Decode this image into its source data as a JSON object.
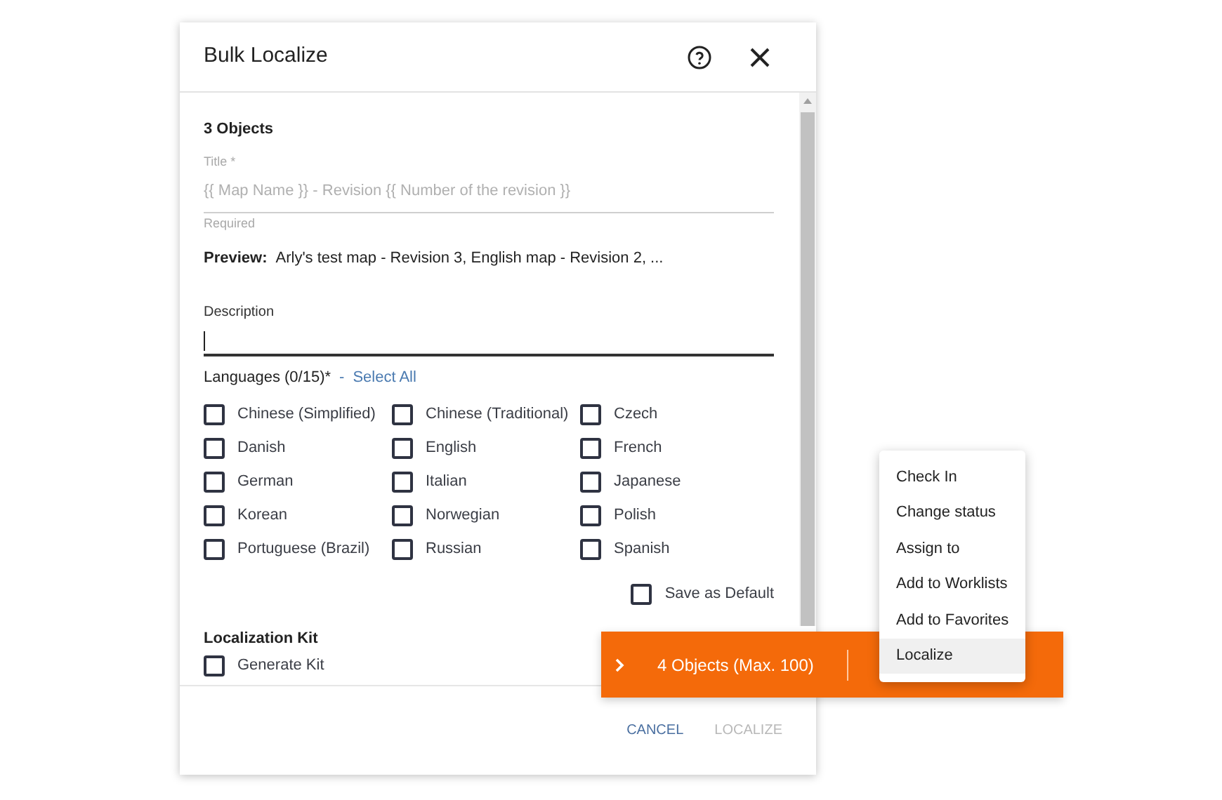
{
  "dialog": {
    "title": "Bulk Localize",
    "objects_heading": "3 Objects",
    "title_field": {
      "label": "Title *",
      "placeholder": "{{ Map Name }} - Revision {{ Number of the revision }}",
      "helper": "Required"
    },
    "preview": {
      "label": "Preview:",
      "text": "Arly's test map - Revision 3, English map - Revision 2, ..."
    },
    "description": {
      "label": "Description"
    },
    "languages": {
      "label": "Languages (0/15)*",
      "separator": "-",
      "select_all": "Select All",
      "items": [
        {
          "label": "Chinese (Simplified)",
          "checked": false
        },
        {
          "label": "Chinese (Traditional)",
          "checked": false
        },
        {
          "label": "Czech",
          "checked": false
        },
        {
          "label": "Danish",
          "checked": false
        },
        {
          "label": "English",
          "checked": false
        },
        {
          "label": "French",
          "checked": false
        },
        {
          "label": "German",
          "checked": false
        },
        {
          "label": "Italian",
          "checked": false
        },
        {
          "label": "Japanese",
          "checked": false
        },
        {
          "label": "Korean",
          "checked": false
        },
        {
          "label": "Norwegian",
          "checked": false
        },
        {
          "label": "Polish",
          "checked": false
        },
        {
          "label": "Portuguese (Brazil)",
          "checked": false
        },
        {
          "label": "Russian",
          "checked": false
        },
        {
          "label": "Spanish",
          "checked": false
        }
      ]
    },
    "save_default": {
      "label": "Save as Default",
      "checked": false
    },
    "localization_kit": {
      "label": "Localization Kit",
      "generate": {
        "label": "Generate Kit",
        "checked": false
      }
    },
    "buttons": [
      {
        "label": "CANCEL",
        "disabled": false
      },
      {
        "label": "LOCALIZE",
        "disabled": true
      }
    ]
  },
  "selection_bar": {
    "text": "4 Objects (Max. 100)"
  },
  "context_menu": [
    {
      "label": "Check In",
      "selected": false
    },
    {
      "label": "Change status",
      "selected": false
    },
    {
      "label": "Assign to",
      "selected": false
    },
    {
      "label": "Add to Worklists",
      "selected": false
    },
    {
      "label": "Add to Favorites",
      "selected": false
    },
    {
      "label": "Localize",
      "selected": true
    }
  ]
}
